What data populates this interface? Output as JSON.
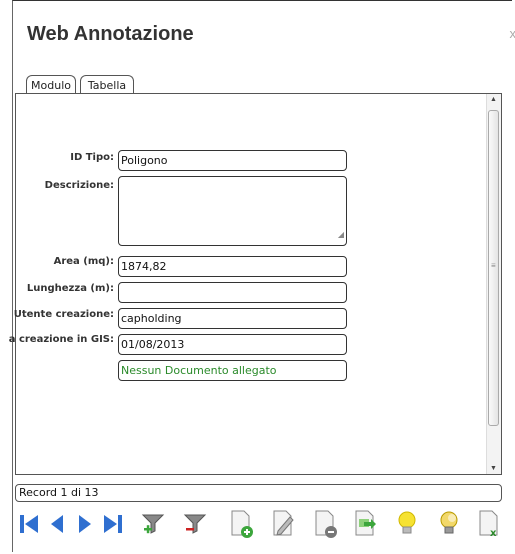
{
  "window": {
    "title": "Web Annotazione",
    "close_glyph": "x"
  },
  "tabs": [
    {
      "label": "Modulo"
    },
    {
      "label": "Tabella"
    }
  ],
  "form": {
    "fields": [
      {
        "label": "ID Tipo:",
        "value": "Poligono"
      },
      {
        "label": "Descrizione:",
        "value": ""
      },
      {
        "label": "Area (mq):",
        "value": "1874,82"
      },
      {
        "label": "Lunghezza (m):",
        "value": ""
      },
      {
        "label": "Utente creazione:",
        "value": "capholding"
      },
      {
        "label": "a creazione in GIS:",
        "value": "01/08/2013"
      }
    ],
    "documents": "Nessun Documento allegato"
  },
  "status": {
    "record": "Record 1 di 13"
  },
  "colors": {
    "nav_blue": "#2f6fd0",
    "doc_green": "#2a8a2a",
    "page_green": "#3ca63c",
    "remove_red": "#cc2222",
    "bulb_yellow": "#f6e232"
  },
  "toolbar": {
    "icons": [
      "first-record-icon",
      "previous-record-icon",
      "next-record-icon",
      "last-record-icon",
      "add-filter-icon",
      "remove-filter-icon",
      "new-record-icon",
      "edit-record-icon",
      "delete-record-icon",
      "export-icon",
      "lightbulb-on-icon",
      "lightbulb-off-icon",
      "excel-export-icon"
    ]
  }
}
